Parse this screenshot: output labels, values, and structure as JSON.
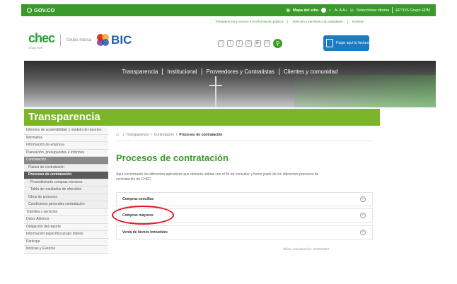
{
  "govbar": {
    "brand": "GOV.CO",
    "mapa": "Mapa del sitio",
    "font_controls": "A- A A+",
    "selector": "Seleccionar idioma",
    "epm": "EPTOS Grupo EPM"
  },
  "toplinks": [
    "Transparencia y acceso a la información pública",
    "Atención y servicios a la ciudadanía",
    "Noticias"
  ],
  "logos": {
    "chec": "chec",
    "chec_sub": "Grupo epm",
    "epm": "Grupo\nmarca",
    "bic": "BIC"
  },
  "socials": [
    "instagram-icon",
    "facebook-icon",
    "twitter-icon",
    "ig-icon",
    "youtube-icon",
    "linkedin-icon"
  ],
  "pay_button": "Pagar aquí tu factura",
  "nav": [
    "Transparencia",
    "Institucional",
    "Proveedores y Contratistas",
    "Clientes y comunidad"
  ],
  "section_title": "Transparencia",
  "sidebar": [
    {
      "label": "Informes de sostenibilidad y modelo de reportes",
      "type": "item"
    },
    {
      "label": "Normativa",
      "type": "item"
    },
    {
      "label": "Información de empresa",
      "type": "item"
    },
    {
      "label": "Planeación, presupuestos e informes",
      "type": "item"
    },
    {
      "label": "Contratación",
      "type": "active"
    },
    {
      "label": "Planes de contratación",
      "type": "sub"
    },
    {
      "label": "Procesos de contratación",
      "type": "subactive"
    },
    {
      "label": "Procedimiento compras menores",
      "type": "subsub"
    },
    {
      "label": "Tabla de resultados de ofrecidos",
      "type": "subsub"
    },
    {
      "label": "Otros de procesos",
      "type": "sub"
    },
    {
      "label": "Condiciones generales contratación",
      "type": "sub"
    },
    {
      "label": "Trámites y servicios",
      "type": "item"
    },
    {
      "label": "Datos Abiertos",
      "type": "item"
    },
    {
      "label": "Obligación del reporte",
      "type": "item"
    },
    {
      "label": "Información específica grupo interés",
      "type": "item"
    },
    {
      "label": "Participa",
      "type": "item"
    },
    {
      "label": "Noticias y Eventos",
      "type": "item"
    }
  ],
  "breadcrumb": {
    "items": [
      "Transparencia",
      "Contratación"
    ],
    "current": "Procesos de contratación"
  },
  "page_title": "Procesos de contratación",
  "description": "Aquí encontrarás los diferentes aplicativos que deberás utilizar con el fin de consultar y hacer parte de los diferentes procesos de contratación de CHEC.",
  "accordion": [
    "Compras sencillas",
    "Compras mayores",
    "Venta de bienes inmuebles"
  ],
  "updated": "Última actualización: 20/05/2024"
}
